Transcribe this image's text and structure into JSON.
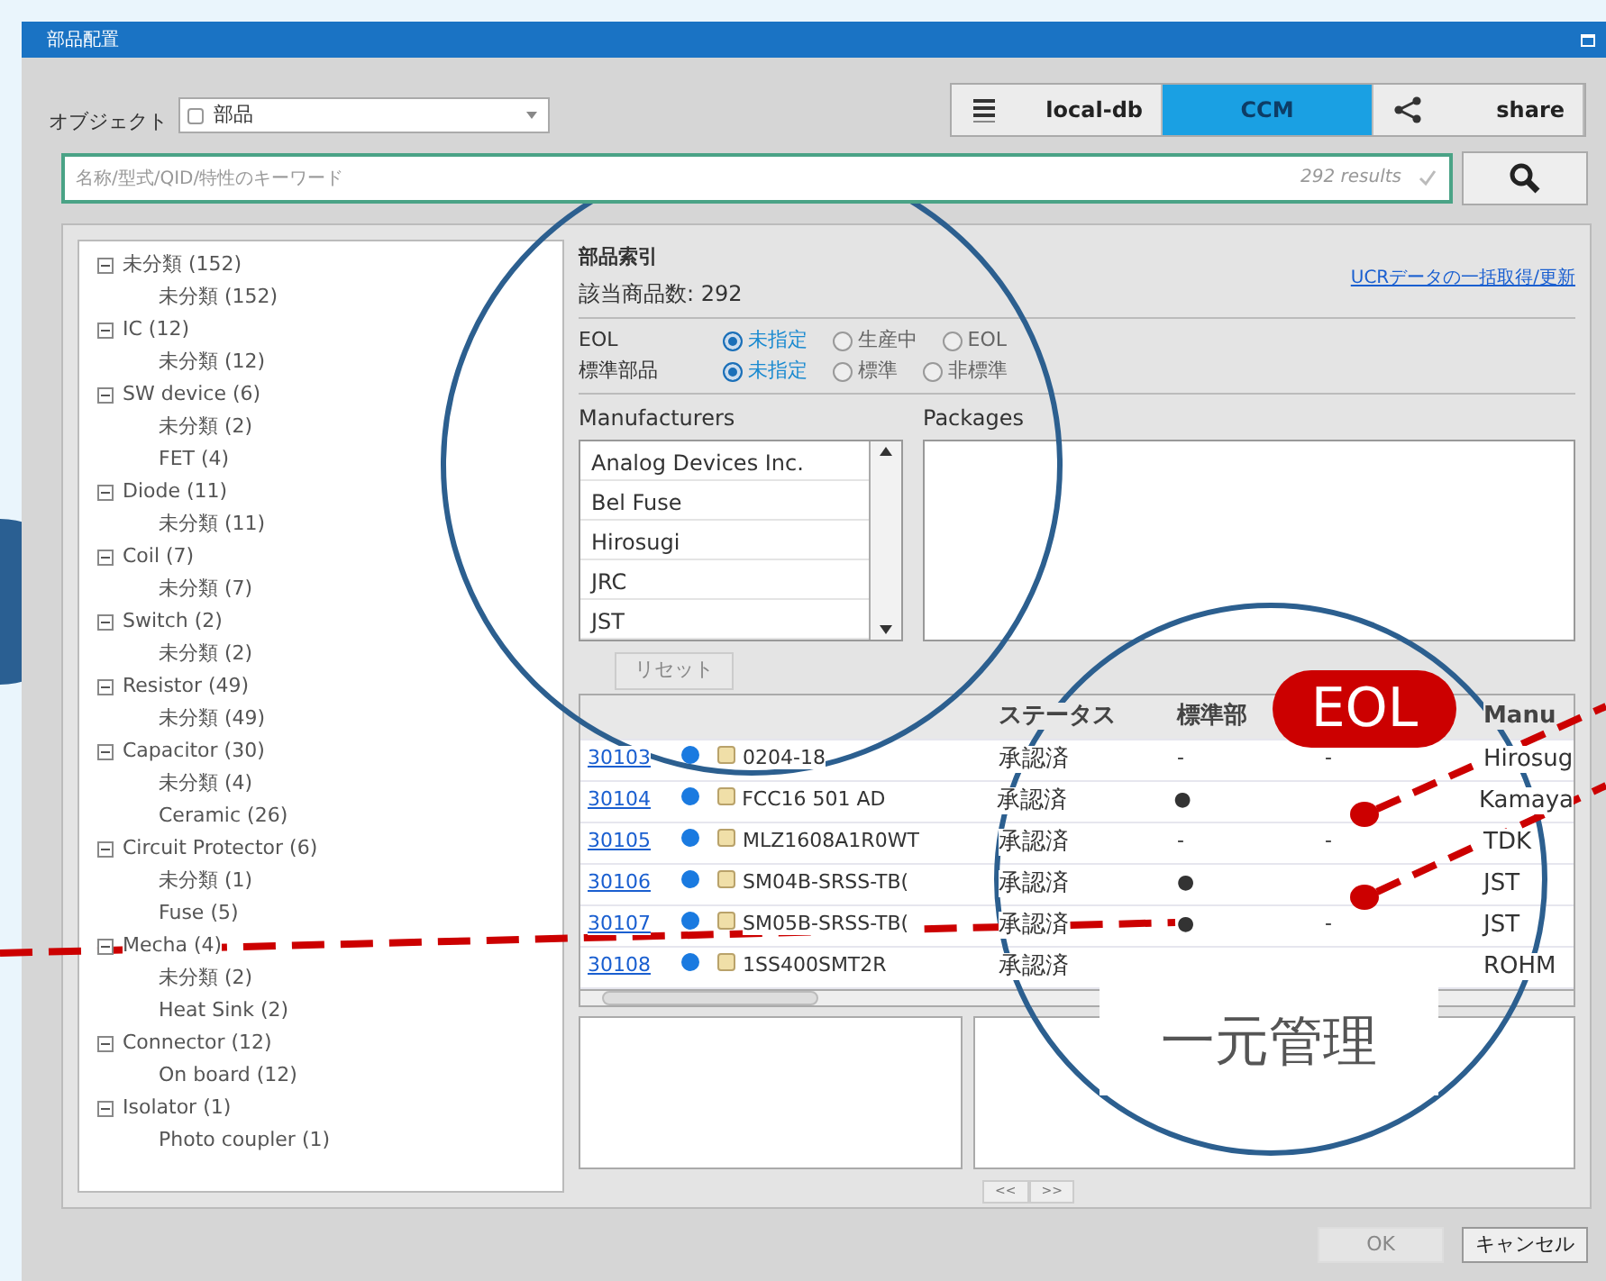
{
  "window": {
    "title": "部品配置"
  },
  "object": {
    "label": "オブジェクト",
    "value": "部品"
  },
  "sources": [
    {
      "kind": "list",
      "label": "local-db",
      "selected": false
    },
    {
      "kind": "plain",
      "label": "CCM",
      "selected": true
    },
    {
      "kind": "share",
      "label": "share",
      "selected": false
    }
  ],
  "search": {
    "placeholder": "名称/型式/QID/特性のキーワード",
    "results": "292 results"
  },
  "tree": [
    {
      "label": "未分類 (152)",
      "expanded": true,
      "children": [
        {
          "label": "未分類 (152)"
        }
      ]
    },
    {
      "label": "IC (12)",
      "expanded": true,
      "children": [
        {
          "label": "未分類 (12)"
        }
      ]
    },
    {
      "label": "SW device (6)",
      "expanded": true,
      "children": [
        {
          "label": "未分類 (2)"
        },
        {
          "label": "FET (4)"
        }
      ]
    },
    {
      "label": "Diode (11)",
      "expanded": true,
      "children": [
        {
          "label": "未分類 (11)"
        }
      ]
    },
    {
      "label": "Coil (7)",
      "expanded": true,
      "children": [
        {
          "label": "未分類 (7)"
        }
      ]
    },
    {
      "label": "Switch (2)",
      "expanded": true,
      "children": [
        {
          "label": "未分類 (2)"
        }
      ]
    },
    {
      "label": "Resistor (49)",
      "expanded": true,
      "children": [
        {
          "label": "未分類 (49)"
        }
      ]
    },
    {
      "label": "Capacitor (30)",
      "expanded": true,
      "children": [
        {
          "label": "未分類 (4)"
        },
        {
          "label": "Ceramic (26)"
        }
      ]
    },
    {
      "label": "Circuit Protector (6)",
      "expanded": true,
      "children": [
        {
          "label": "未分類 (1)"
        },
        {
          "label": "Fuse (5)"
        }
      ]
    },
    {
      "label": "Mecha (4)",
      "expanded": true,
      "children": [
        {
          "label": "未分類 (2)"
        },
        {
          "label": "Heat Sink (2)"
        }
      ]
    },
    {
      "label": "Connector (12)",
      "expanded": true,
      "children": [
        {
          "label": "On board (12)"
        }
      ]
    },
    {
      "label": "Isolator (1)",
      "expanded": true,
      "children": [
        {
          "label": "Photo coupler (1)"
        }
      ]
    }
  ],
  "index": {
    "title": "部品索引",
    "count": "該当商品数: 292",
    "link": "UCRデータの一括取得/更新"
  },
  "filters": [
    {
      "label": "EOL",
      "options": [
        {
          "label": "未指定",
          "selected": true
        },
        {
          "label": "生産中",
          "selected": false
        },
        {
          "label": "EOL",
          "selected": false
        }
      ]
    },
    {
      "label": "標準部品",
      "options": [
        {
          "label": "未指定",
          "selected": true
        },
        {
          "label": "標準",
          "selected": false
        },
        {
          "label": "非標準",
          "selected": false
        }
      ]
    }
  ],
  "manufacturers": {
    "label": "Manufacturers",
    "items": [
      "Analog Devices Inc.",
      "Bel Fuse",
      "Hirosugi",
      "JRC",
      "JST"
    ]
  },
  "packages": {
    "label": "Packages"
  },
  "reset": {
    "label": "リセット",
    "disabled": true
  },
  "table": {
    "columns": [
      "ステータス",
      "標準部",
      "Manu"
    ],
    "rows": [
      {
        "id": "30103",
        "name": "0204-18",
        "status": "承認済",
        "standard": "-",
        "eol": "-",
        "manufacturer": "Hirosug"
      },
      {
        "id": "30104",
        "name": "FCC16 501 AD",
        "status": "承認済",
        "standard": "●",
        "manufacturer": "Kamaya"
      },
      {
        "id": "30105",
        "name": "MLZ1608A1R0WT",
        "status": "承認済",
        "standard": "-",
        "eol": "-",
        "manufacturer": "TDK"
      },
      {
        "id": "30106",
        "name": "SM04B-SRSS-TB(",
        "status": "承認済",
        "standard": "●",
        "manufacturer": "JST"
      },
      {
        "id": "30107",
        "name": "SM05B-SRSS-TB(",
        "status": "承認済",
        "standard": "●",
        "eol": "-",
        "manufacturer": "JST"
      },
      {
        "id": "30108",
        "name": "1SS400SMT2R",
        "status": "承認済",
        "manufacturer": "ROHM"
      }
    ]
  },
  "pager": [
    "<<",
    ">>"
  ],
  "buttons": [
    {
      "label": "OK",
      "disabled": true
    },
    {
      "label": "キャンセル",
      "disabled": false
    }
  ],
  "callouts": {
    "badge": "EOL",
    "label": "一元管理"
  }
}
